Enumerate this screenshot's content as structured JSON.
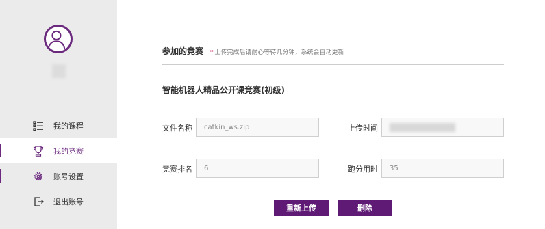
{
  "colors": {
    "accent": "#6b2a7e",
    "button": "#5e1a75",
    "sidebar_bg": "#ebebeb"
  },
  "sidebar": {
    "items": [
      {
        "label": "我的课程",
        "icon": "list-icon"
      },
      {
        "label": "我的竞赛",
        "icon": "trophy-icon"
      },
      {
        "label": "账号设置",
        "icon": "gear-icon"
      },
      {
        "label": "退出账号",
        "icon": "logout-icon"
      }
    ]
  },
  "main": {
    "section_title": "参加的竞赛",
    "note_star": "*",
    "note": "上传完成后请耐心等待几分钟，系统会自动更新",
    "contest_name": "智能机器人精品公开课竞赛(初级)",
    "fields": {
      "file_name": {
        "label": "文件名称",
        "value": "catkin_ws.zip"
      },
      "upload_time": {
        "label": "上传时间",
        "value": ""
      },
      "rank": {
        "label": "竞赛排名",
        "value": "6"
      },
      "duration": {
        "label": "跑分用时",
        "value": "35"
      }
    },
    "buttons": {
      "reupload": "重新上传",
      "delete": "删除"
    }
  }
}
